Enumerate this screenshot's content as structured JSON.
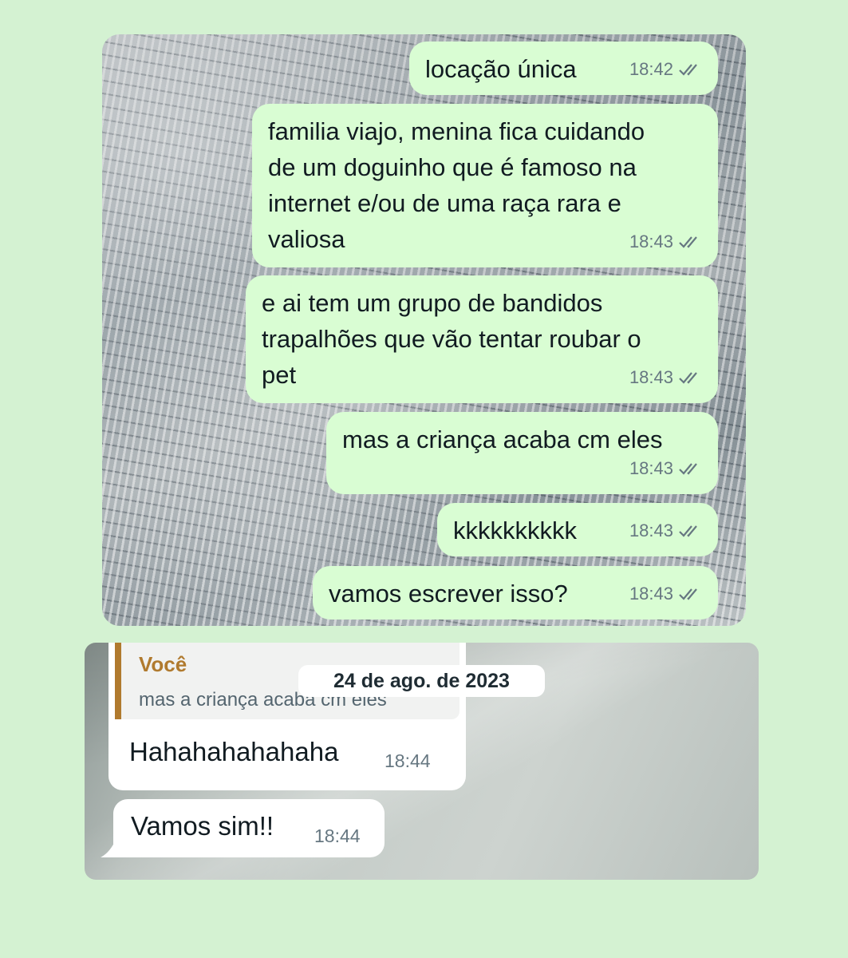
{
  "top_chat": {
    "messages": [
      {
        "text": "locação única",
        "time": "18:42"
      },
      {
        "text": "familia viajo, menina fica cuidando\nde um doguinho que é famoso na\ninternet e/ou de uma raça rara e\nvaliosa",
        "time": "18:43"
      },
      {
        "text": "e ai tem um grupo de bandidos\ntrapalhões que vão tentar roubar o\npet",
        "time": "18:43"
      },
      {
        "text": "mas a criança acaba cm eles",
        "time": "18:43"
      },
      {
        "text": "kkkkkkkkkk",
        "time": "18:43"
      },
      {
        "text": "vamos escrever isso?",
        "time": "18:43"
      }
    ],
    "status_icon": "double-check-icon"
  },
  "bottom_chat": {
    "date_chip": "24 de ago. de 2023",
    "reply": {
      "author": "Você",
      "quoted_text": "mas a criança acaba cm eles"
    },
    "messages": [
      {
        "text": "Hahahahahahaha",
        "time": "18:44"
      },
      {
        "text": "Vamos sim!!",
        "time": "18:44"
      }
    ]
  },
  "colors": {
    "outgoing_bubble": "#d9fdd3",
    "incoming_bubble": "#ffffff",
    "reply_accent": "#b07a2e",
    "page_background": "#d4f2d2"
  }
}
